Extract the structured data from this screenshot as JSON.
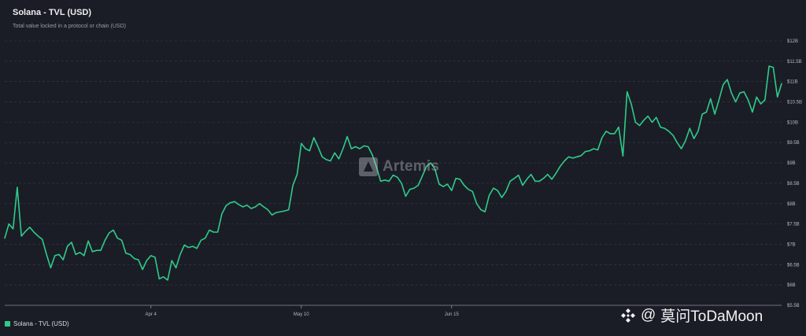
{
  "header": {
    "title": "Solana - TVL (USD)",
    "subtitle": "Total value locked in a protocol or chain (USD)"
  },
  "legend": {
    "label": "Solana - TVL (USD)",
    "color": "#2ecc8a"
  },
  "watermark": {
    "text": "Artemis"
  },
  "credit": {
    "at": "@",
    "name": "莫问ToDaMoon"
  },
  "colors": {
    "background": "#1b1d26",
    "grid": "#3a3c46",
    "line": "#2ecc8a",
    "tick_text": "#b6b8c0"
  },
  "chart_data": {
    "type": "line",
    "title": "Solana - TVL (USD)",
    "subtitle": "Total value locked in a protocol or chain (USD)",
    "x_tick_labels": [
      {
        "label": "Apr 4",
        "index": 35
      },
      {
        "label": "May 10",
        "index": 71
      },
      {
        "label": "Jun 15",
        "index": 107
      }
    ],
    "y_tick_labels": [
      "$5.5B",
      "$6B",
      "$6.5B",
      "$7B",
      "$7.5B",
      "$8B",
      "$8.5B",
      "$9B",
      "$9.5B",
      "$10B",
      "$10.5B",
      "$11B",
      "$11.5B",
      "$12B"
    ],
    "ylim": [
      5.5,
      12
    ],
    "grid": true,
    "legend_position": "bottom-left",
    "series": [
      {
        "name": "Solana - TVL (USD)",
        "values": [
          7.15,
          7.5,
          7.38,
          8.4,
          7.2,
          7.32,
          7.42,
          7.3,
          7.2,
          7.12,
          6.75,
          6.42,
          6.72,
          6.75,
          6.62,
          6.95,
          7.05,
          6.75,
          6.8,
          6.72,
          7.08,
          6.82,
          6.85,
          6.85,
          7.1,
          7.28,
          7.35,
          7.15,
          7.1,
          6.78,
          6.75,
          6.65,
          6.62,
          6.38,
          6.6,
          6.72,
          6.68,
          6.15,
          6.2,
          6.12,
          6.6,
          6.42,
          6.75,
          6.98,
          6.92,
          6.95,
          6.9,
          7.1,
          7.15,
          7.35,
          7.3,
          7.3,
          7.75,
          7.95,
          8.02,
          8.05,
          7.98,
          7.92,
          7.96,
          7.88,
          7.92,
          8.0,
          7.92,
          7.85,
          7.72,
          7.78,
          7.8,
          7.82,
          7.85,
          8.45,
          8.72,
          9.48,
          9.35,
          9.3,
          9.62,
          9.4,
          9.15,
          9.08,
          9.05,
          9.25,
          9.1,
          9.35,
          9.65,
          9.35,
          9.4,
          9.35,
          9.42,
          9.4,
          9.2,
          8.9,
          8.55,
          8.58,
          8.55,
          8.7,
          8.65,
          8.5,
          8.18,
          8.35,
          8.38,
          8.45,
          8.68,
          8.92,
          9.0,
          8.85,
          8.48,
          8.42,
          8.48,
          8.32,
          8.62,
          8.6,
          8.45,
          8.35,
          8.3,
          8.0,
          7.85,
          7.8,
          8.2,
          8.38,
          8.32,
          8.15,
          8.3,
          8.55,
          8.62,
          8.7,
          8.45,
          8.6,
          8.72,
          8.55,
          8.55,
          8.62,
          8.72,
          8.6,
          8.75,
          8.92,
          9.05,
          9.15,
          9.12,
          9.15,
          9.18,
          9.28,
          9.3,
          9.35,
          9.32,
          9.62,
          9.78,
          9.72,
          9.72,
          9.88,
          9.17,
          10.75,
          10.45,
          10.0,
          9.92,
          10.05,
          10.15,
          10.0,
          10.12,
          9.88,
          9.85,
          9.78,
          9.68,
          9.5,
          9.35,
          9.55,
          9.85,
          9.6,
          9.78,
          10.2,
          10.25,
          10.58,
          10.2,
          10.55,
          10.92,
          11.05,
          10.72,
          10.5,
          10.72,
          10.75,
          10.55,
          10.25,
          10.62,
          10.45,
          10.55,
          11.38,
          11.35,
          10.62,
          10.95
        ]
      }
    ]
  }
}
